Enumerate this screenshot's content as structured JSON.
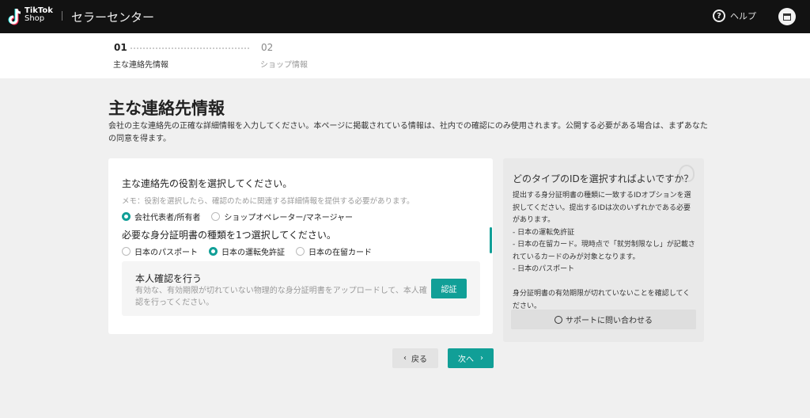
{
  "header": {
    "logo_line1": "TikTok",
    "logo_line2": "Shop",
    "title": "セラーセンター",
    "help": "ヘルプ"
  },
  "stepper": {
    "steps": [
      {
        "num": "01",
        "label": "主な連絡先情報",
        "active": true
      },
      {
        "num": "02",
        "label": "ショップ情報",
        "active": false
      }
    ]
  },
  "page": {
    "title": "主な連絡先情報",
    "description": "会社の主な連絡先の正確な詳細情報を入力してください。本ページに掲載されている情報は、社内での確認にのみ使用されます。公開する必要がある場合は、まずあなたの同意を得ます。"
  },
  "form": {
    "role_question": "主な連絡先の役割を選択してください。",
    "memo": "メモ：役割を選択したら、確認のために関連する詳細情報を提供する必要があります。",
    "roles": [
      {
        "label": "会社代表者/所有者",
        "selected": true
      },
      {
        "label": "ショップオペレーター/マネージャー",
        "selected": false
      }
    ],
    "id_question": "必要な身分証明書の種類を1つ選択してください。",
    "id_types": [
      {
        "label": "日本のパスポート",
        "selected": false
      },
      {
        "label": "日本の運転免許証",
        "selected": true
      },
      {
        "label": "日本の在留カード",
        "selected": false
      }
    ],
    "verify": {
      "title": "本人確認を行う",
      "description": "有効な、有効期限が切れていない物理的な身分証明書をアップロードして、本人確認を行ってください。",
      "button": "認証"
    }
  },
  "help_panel": {
    "title": "どのタイプのIDを選択すればよいですか？",
    "body": "提出する身分証明書の種類に一致するIDオプションを選択してください。提出するIDは次のいずれかである必要があります。\n- 日本の運転免許証\n- 日本の在留カード。現時点で「就労制限なし」が記載されているカードのみが対象となります。\n- 日本のパスポート\n\n身分証明書の有効期限が切れていないことを確認してください。",
    "support_button": "サポートに問い合わせる"
  },
  "nav": {
    "back": "戻る",
    "next": "次へ"
  },
  "colors": {
    "accent": "#119f97",
    "header_bg": "#121212"
  }
}
